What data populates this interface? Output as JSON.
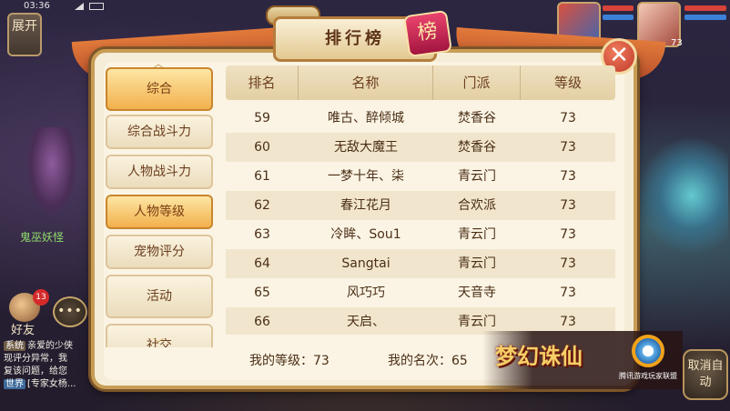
{
  "status_bar": {
    "time": "03:36"
  },
  "hud": {
    "expand_label": "展开",
    "monster_name": "鬼巫妖怪",
    "friend_badge": "13",
    "friend_label": "好友",
    "chat_button": "•••",
    "portrait_level": "73",
    "cancel_auto": "取消自动",
    "chat_lines": [
      {
        "tag": "系统",
        "text": "亲爱的少侠"
      },
      {
        "tag": "",
        "text": "现评分异常，我"
      },
      {
        "tag": "",
        "text": "复该问题，给您"
      },
      {
        "tag": "世界",
        "text": "[专家女杨..."
      }
    ]
  },
  "panel": {
    "title": "排行榜",
    "seal": "榜",
    "close_icon": "close-icon"
  },
  "categories": [
    {
      "label": "综合",
      "active": true,
      "style": "main"
    },
    {
      "label": "综合战斗力",
      "active": false
    },
    {
      "label": "人物战斗力",
      "active": false
    },
    {
      "label": "人物等级",
      "active": true
    },
    {
      "label": "宠物评分",
      "active": false
    },
    {
      "label": "活动",
      "active": false,
      "style": "main"
    },
    {
      "label": "社交",
      "active": false,
      "style": "main"
    }
  ],
  "table": {
    "headers": [
      "排名",
      "名称",
      "门派",
      "等级"
    ],
    "rows": [
      [
        "59",
        "唯古、醉倾城",
        "焚香谷",
        "73"
      ],
      [
        "60",
        "无敌大魔王",
        "焚香谷",
        "73"
      ],
      [
        "61",
        "一梦十年、柒",
        "青云门",
        "73"
      ],
      [
        "62",
        "春江花月",
        "合欢派",
        "73"
      ],
      [
        "63",
        "冷眸、Sou1",
        "青云门",
        "73"
      ],
      [
        "64",
        "Sangtai",
        "青云门",
        "73"
      ],
      [
        "65",
        "风巧巧",
        "天音寺",
        "73"
      ],
      [
        "66",
        "天启、",
        "青云门",
        "73"
      ]
    ]
  },
  "footer": {
    "my_level": "我的等级：73",
    "my_rank": "我的名次：65"
  },
  "logo": {
    "game_title": "梦幻诛仙",
    "publisher": "腾讯游戏玩家联盟"
  }
}
